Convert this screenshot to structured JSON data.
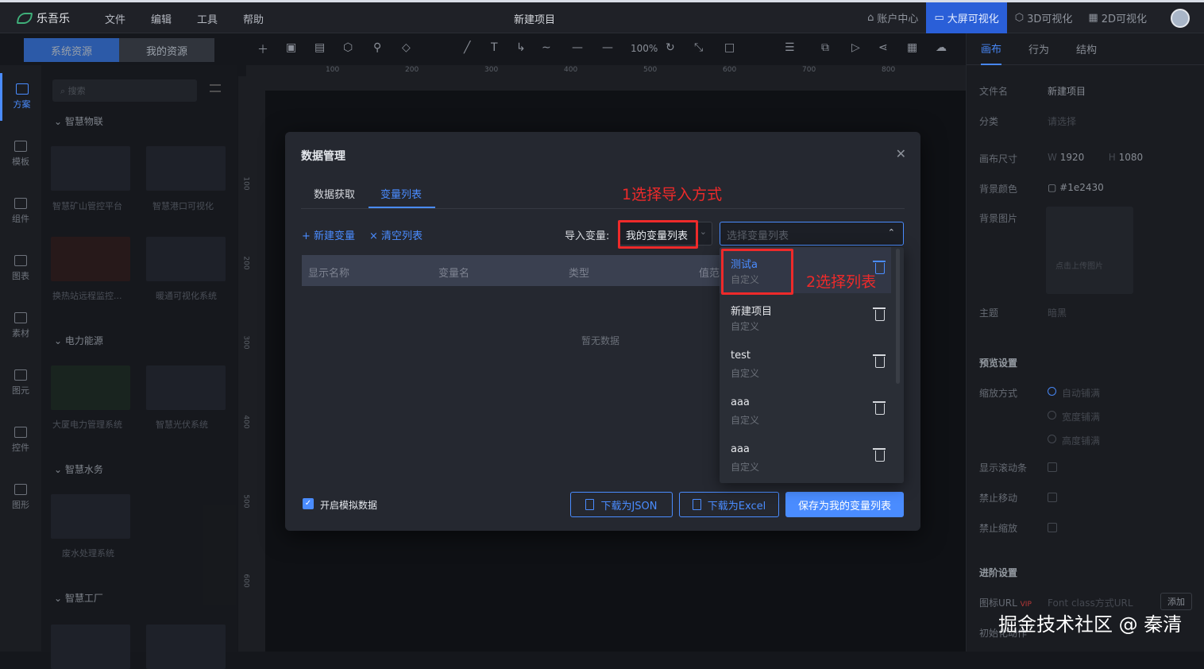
{
  "app": {
    "name": "乐吾乐",
    "project_title": "新建项目"
  },
  "menu": [
    "文件",
    "编辑",
    "工具",
    "帮助"
  ],
  "top_right": {
    "account": "账户中心",
    "bigscreen": "大屏可视化",
    "viz3d": "3D可视化",
    "viz2d": "2D可视化"
  },
  "resource_tabs": [
    "系统资源",
    "我的资源"
  ],
  "toolbar": {
    "zoom": "100%"
  },
  "ruler_h": [
    "100",
    "200",
    "300",
    "400",
    "500",
    "600",
    "700",
    "800"
  ],
  "ruler_v": [
    "100",
    "200",
    "300",
    "400",
    "500",
    "600"
  ],
  "sidebar": [
    "方案",
    "模板",
    "组件",
    "图表",
    "素材",
    "图元",
    "控件",
    "图形"
  ],
  "resources": {
    "search_placeholder": "搜索",
    "categories": [
      "智慧物联",
      "电力能源",
      "智慧水务",
      "智慧工厂"
    ],
    "items": [
      "智慧矿山管控平台",
      "智慧港口可视化",
      "换热站远程监控...",
      "暖通可视化系统",
      "大厦电力管理系统",
      "智慧光伏系统",
      "废水处理系统"
    ]
  },
  "props": {
    "tabs": [
      "画布",
      "行为",
      "结构"
    ],
    "file_name_label": "文件名",
    "file_name": "新建项目",
    "category_label": "分类",
    "category_placeholder": "请选择",
    "size_label": "画布尺寸",
    "w_label": "W",
    "width": "1920",
    "h_label": "H",
    "height": "1080",
    "bg_color_label": "背景颜色",
    "bg_color": "#1e2430",
    "bg_image_label": "背景图片",
    "bg_image_hint": "点击上传图片",
    "theme_label": "主题",
    "theme_value": "暗黑",
    "preview_title": "预览设置",
    "scale_label": "缩放方式",
    "scale_options": [
      "自动铺满",
      "宽度铺满",
      "高度铺满"
    ],
    "scrollbar_label": "显示滚动条",
    "no_move_label": "禁止移动",
    "no_zoom_label": "禁止缩放",
    "advanced_title": "进阶设置",
    "icon_url_label": "图标URL",
    "vip": "VIP",
    "icon_url_placeholder": "Font class方式URL",
    "add_button": "添加",
    "init_label": "初始化动作"
  },
  "modal": {
    "title": "数据管理",
    "tabs": [
      "数据获取",
      "变量列表"
    ],
    "add_var": "+ 新建变量",
    "clear_list": "× 清空列表",
    "import_label": "导入变量:",
    "import_mode": "我的变量列表",
    "list_placeholder": "选择变量列表",
    "columns": [
      "显示名称",
      "变量名",
      "类型",
      "值范"
    ],
    "empty": "暂无数据",
    "mock_label": "开启模拟数据",
    "btn_json": "下载为JSON",
    "btn_excel": "下载为Excel",
    "btn_save": "保存为我的变量列表"
  },
  "dropdown_items": [
    {
      "name": "测试a",
      "sub": "自定义"
    },
    {
      "name": "新建项目",
      "sub": "自定义"
    },
    {
      "name": "test",
      "sub": "自定义"
    },
    {
      "name": "aaa",
      "sub": "自定义"
    },
    {
      "name": "aaa",
      "sub": "自定义"
    }
  ],
  "annotations": {
    "step1": "1选择导入方式",
    "step2": "2选择列表"
  },
  "watermark": "掘金技术社区 @ 秦清",
  "colors": {
    "accent": "#4a8cff",
    "annotation": "#ee2a2a",
    "modal_bg": "#252830"
  }
}
